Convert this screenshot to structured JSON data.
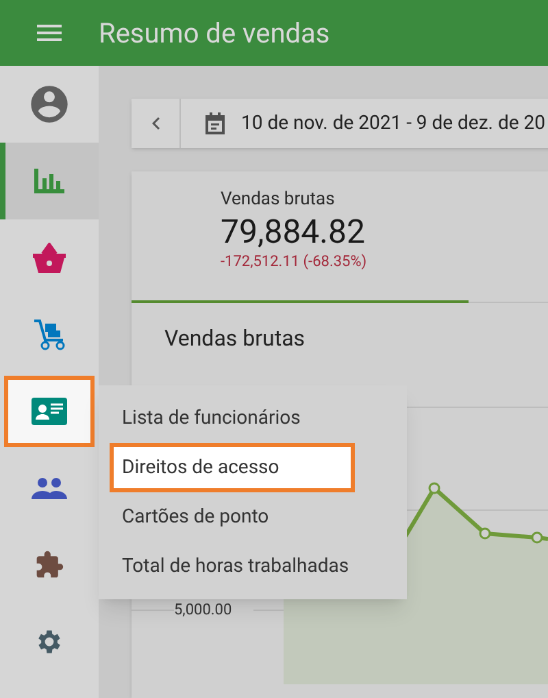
{
  "app_bar": {
    "title": "Resumo de vendas"
  },
  "sidebar": {
    "items": [
      {
        "kind": "profile",
        "selected": false,
        "highlighted": false
      },
      {
        "kind": "reports",
        "selected": true,
        "highlighted": false
      },
      {
        "kind": "sales",
        "selected": false,
        "highlighted": false
      },
      {
        "kind": "delivery",
        "selected": false,
        "highlighted": false
      },
      {
        "kind": "employees",
        "selected": false,
        "highlighted": true
      },
      {
        "kind": "customers",
        "selected": false,
        "highlighted": false
      },
      {
        "kind": "addons",
        "selected": false,
        "highlighted": false
      },
      {
        "kind": "settings",
        "selected": false,
        "highlighted": false
      }
    ]
  },
  "date_bar": {
    "range": "10 de nov. de 2021 - 9 de dez. de 20"
  },
  "summary_card": {
    "label": "Vendas brutas",
    "value": "79,884.82",
    "change": "-172,512.11 (-68.35%)"
  },
  "chart_panel": {
    "title": "Vendas brutas",
    "y_tick": "5,000.00"
  },
  "menu": {
    "items": [
      {
        "label": "Lista de funcionários",
        "highlighted": false
      },
      {
        "label": "Direitos de acesso",
        "highlighted": true
      },
      {
        "label": "Cartões de ponto",
        "highlighted": false
      },
      {
        "label": "Total de horas trabalhadas",
        "highlighted": false
      }
    ]
  }
}
